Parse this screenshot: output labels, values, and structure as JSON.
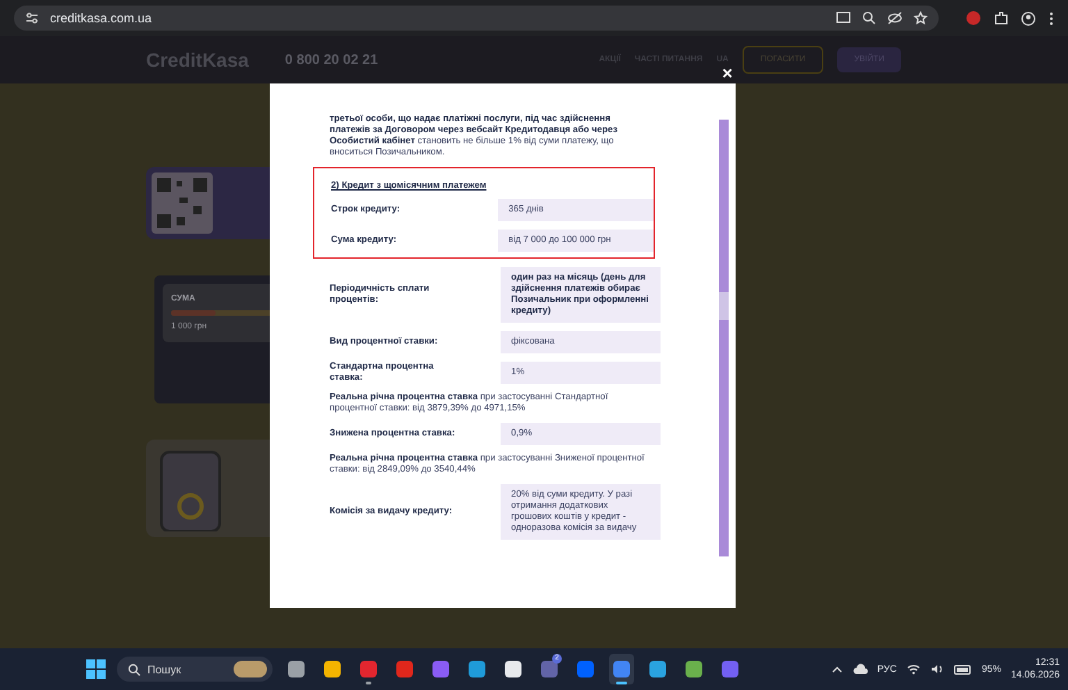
{
  "browser": {
    "url": "creditkasa.com.ua"
  },
  "site": {
    "logo": "CreditKasa",
    "phone": "0 800 20 02 21",
    "nav": [
      "АКЦІЇ",
      "ЧАСТІ ПИТАННЯ",
      "UA"
    ],
    "buttons": [
      "ПОГАСИТИ",
      "УВІЙТИ"
    ],
    "calculator": {
      "label": "СУМА",
      "level": 0.4,
      "amount": "1 000 грн"
    }
  },
  "modal": {
    "close": "×",
    "intro": "**третьої особи, що надає платіжні послуги, під час здійснення платежів за Договором через вебсайт Кредитодавця або через Особистий кабінет** становить не більше 1% від суми платежу, що вноситься Позичальником.",
    "highlight": {
      "title": "2) Кредит з щомісячним платежем",
      "rows": [
        {
          "kind": "pair",
          "label": "Строк кредиту:",
          "value": "365 днів",
          "bold": false
        },
        {
          "kind": "pair",
          "label": "Сума кредиту:",
          "value": "від 7 000 до 100 000 грн",
          "bold": false
        }
      ]
    },
    "rows": [
      {
        "kind": "pair",
        "label": "Періодичність сплати процентів:",
        "value": "один раз на місяць (день для здійснення платежів обирає Позичальник при оформленні кредиту)",
        "bold": true
      },
      {
        "kind": "pair",
        "label": "Вид процентної ставки:",
        "value": "фіксована",
        "bold": false
      },
      {
        "kind": "pair",
        "label": "Стандартна процентна ставка:",
        "value": "1%",
        "bold": false
      },
      {
        "kind": "note",
        "text": "**Реальна річна процентна ставка** при застосуванні Стандартної процентної ставки: від 3879,39% до 4971,15%"
      },
      {
        "kind": "pair",
        "label": "Знижена процентна ставка:",
        "value": "0,9%",
        "bold": false
      },
      {
        "kind": "note",
        "text": "**Реальна річна процентна ставка** при застосуванні Зниженої процентної ставки: від 2849,09% до 3540,44%"
      },
      {
        "kind": "pair",
        "label": "Комісія за видачу кредиту:",
        "value": "20% від суми кредиту. У разі отримання додаткових грошових коштів у кредит - одноразова комісія за видачу",
        "bold": false
      }
    ]
  },
  "taskbar": {
    "search": "Пошук",
    "apps": [
      {
        "open": false,
        "active": false
      },
      {
        "open": false,
        "active": false
      },
      {
        "open": true,
        "active": false
      },
      {
        "open": false,
        "active": false
      },
      {
        "open": false,
        "active": false
      },
      {
        "open": false,
        "active": false
      },
      {
        "open": false,
        "active": false
      },
      {
        "open": false,
        "active": false,
        "badge": "2"
      },
      {
        "open": false,
        "active": false
      },
      {
        "open": true,
        "active": true
      },
      {
        "open": false,
        "active": false
      },
      {
        "open": false,
        "active": false
      },
      {
        "open": false,
        "active": false
      }
    ],
    "language": "РУС",
    "battery": "95%",
    "time": "12:31",
    "date": "14.06.2026"
  }
}
